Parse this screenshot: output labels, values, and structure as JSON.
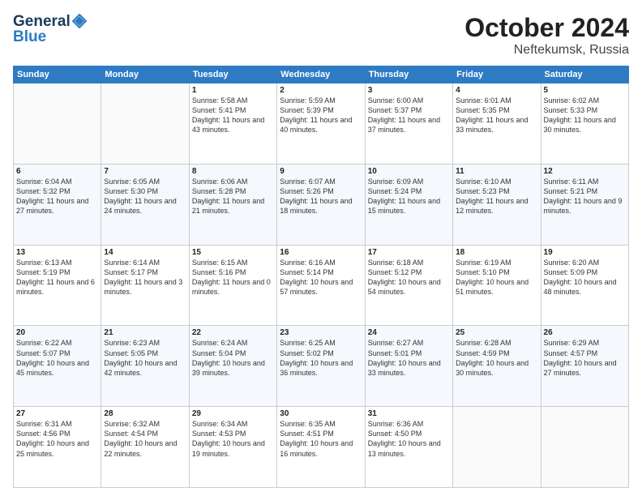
{
  "header": {
    "logo_line1": "General",
    "logo_line2": "Blue",
    "month": "October 2024",
    "location": "Neftekumsk, Russia"
  },
  "weekdays": [
    "Sunday",
    "Monday",
    "Tuesday",
    "Wednesday",
    "Thursday",
    "Friday",
    "Saturday"
  ],
  "weeks": [
    [
      {
        "day": "",
        "info": ""
      },
      {
        "day": "",
        "info": ""
      },
      {
        "day": "1",
        "info": "Sunrise: 5:58 AM\nSunset: 5:41 PM\nDaylight: 11 hours and 43 minutes."
      },
      {
        "day": "2",
        "info": "Sunrise: 5:59 AM\nSunset: 5:39 PM\nDaylight: 11 hours and 40 minutes."
      },
      {
        "day": "3",
        "info": "Sunrise: 6:00 AM\nSunset: 5:37 PM\nDaylight: 11 hours and 37 minutes."
      },
      {
        "day": "4",
        "info": "Sunrise: 6:01 AM\nSunset: 5:35 PM\nDaylight: 11 hours and 33 minutes."
      },
      {
        "day": "5",
        "info": "Sunrise: 6:02 AM\nSunset: 5:33 PM\nDaylight: 11 hours and 30 minutes."
      }
    ],
    [
      {
        "day": "6",
        "info": "Sunrise: 6:04 AM\nSunset: 5:32 PM\nDaylight: 11 hours and 27 minutes."
      },
      {
        "day": "7",
        "info": "Sunrise: 6:05 AM\nSunset: 5:30 PM\nDaylight: 11 hours and 24 minutes."
      },
      {
        "day": "8",
        "info": "Sunrise: 6:06 AM\nSunset: 5:28 PM\nDaylight: 11 hours and 21 minutes."
      },
      {
        "day": "9",
        "info": "Sunrise: 6:07 AM\nSunset: 5:26 PM\nDaylight: 11 hours and 18 minutes."
      },
      {
        "day": "10",
        "info": "Sunrise: 6:09 AM\nSunset: 5:24 PM\nDaylight: 11 hours and 15 minutes."
      },
      {
        "day": "11",
        "info": "Sunrise: 6:10 AM\nSunset: 5:23 PM\nDaylight: 11 hours and 12 minutes."
      },
      {
        "day": "12",
        "info": "Sunrise: 6:11 AM\nSunset: 5:21 PM\nDaylight: 11 hours and 9 minutes."
      }
    ],
    [
      {
        "day": "13",
        "info": "Sunrise: 6:13 AM\nSunset: 5:19 PM\nDaylight: 11 hours and 6 minutes."
      },
      {
        "day": "14",
        "info": "Sunrise: 6:14 AM\nSunset: 5:17 PM\nDaylight: 11 hours and 3 minutes."
      },
      {
        "day": "15",
        "info": "Sunrise: 6:15 AM\nSunset: 5:16 PM\nDaylight: 11 hours and 0 minutes."
      },
      {
        "day": "16",
        "info": "Sunrise: 6:16 AM\nSunset: 5:14 PM\nDaylight: 10 hours and 57 minutes."
      },
      {
        "day": "17",
        "info": "Sunrise: 6:18 AM\nSunset: 5:12 PM\nDaylight: 10 hours and 54 minutes."
      },
      {
        "day": "18",
        "info": "Sunrise: 6:19 AM\nSunset: 5:10 PM\nDaylight: 10 hours and 51 minutes."
      },
      {
        "day": "19",
        "info": "Sunrise: 6:20 AM\nSunset: 5:09 PM\nDaylight: 10 hours and 48 minutes."
      }
    ],
    [
      {
        "day": "20",
        "info": "Sunrise: 6:22 AM\nSunset: 5:07 PM\nDaylight: 10 hours and 45 minutes."
      },
      {
        "day": "21",
        "info": "Sunrise: 6:23 AM\nSunset: 5:05 PM\nDaylight: 10 hours and 42 minutes."
      },
      {
        "day": "22",
        "info": "Sunrise: 6:24 AM\nSunset: 5:04 PM\nDaylight: 10 hours and 39 minutes."
      },
      {
        "day": "23",
        "info": "Sunrise: 6:25 AM\nSunset: 5:02 PM\nDaylight: 10 hours and 36 minutes."
      },
      {
        "day": "24",
        "info": "Sunrise: 6:27 AM\nSunset: 5:01 PM\nDaylight: 10 hours and 33 minutes."
      },
      {
        "day": "25",
        "info": "Sunrise: 6:28 AM\nSunset: 4:59 PM\nDaylight: 10 hours and 30 minutes."
      },
      {
        "day": "26",
        "info": "Sunrise: 6:29 AM\nSunset: 4:57 PM\nDaylight: 10 hours and 27 minutes."
      }
    ],
    [
      {
        "day": "27",
        "info": "Sunrise: 6:31 AM\nSunset: 4:56 PM\nDaylight: 10 hours and 25 minutes."
      },
      {
        "day": "28",
        "info": "Sunrise: 6:32 AM\nSunset: 4:54 PM\nDaylight: 10 hours and 22 minutes."
      },
      {
        "day": "29",
        "info": "Sunrise: 6:34 AM\nSunset: 4:53 PM\nDaylight: 10 hours and 19 minutes."
      },
      {
        "day": "30",
        "info": "Sunrise: 6:35 AM\nSunset: 4:51 PM\nDaylight: 10 hours and 16 minutes."
      },
      {
        "day": "31",
        "info": "Sunrise: 6:36 AM\nSunset: 4:50 PM\nDaylight: 10 hours and 13 minutes."
      },
      {
        "day": "",
        "info": ""
      },
      {
        "day": "",
        "info": ""
      }
    ]
  ]
}
